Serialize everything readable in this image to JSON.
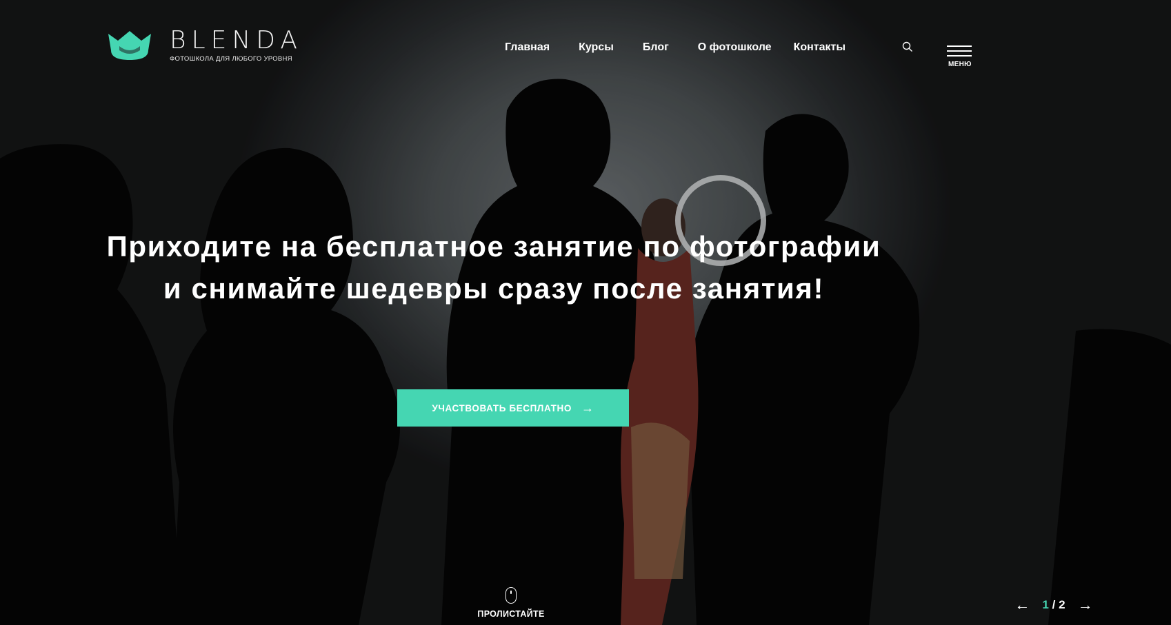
{
  "brand": {
    "name": "BLENDA",
    "tagline": "ФОТОШКОЛА ДЛЯ ЛЮБОГО УРОВНЯ",
    "accent_color": "#45d6b2"
  },
  "nav": {
    "items": [
      {
        "label": "Главная"
      },
      {
        "label": "Курсы"
      },
      {
        "label": "Блог"
      },
      {
        "label": "О фотошколе"
      },
      {
        "label": "Контакты"
      }
    ],
    "search_icon": "search-icon",
    "menu_label": "МЕНЮ"
  },
  "hero": {
    "title": "Приходите на бесплатное занятие по фотографии и снимайте шедевры сразу после занятия!",
    "cta_label": "УЧАСТВОВАТЬ БЕСПЛАТНО",
    "cta_icon": "arrow-right-icon"
  },
  "footer": {
    "scroll_label": "ПРОЛИСТАЙТЕ",
    "scroll_icon": "mouse-icon",
    "pager": {
      "current": "1",
      "separator": "/",
      "total": "2",
      "prev_icon": "arrow-left-icon",
      "next_icon": "arrow-right-icon"
    }
  }
}
